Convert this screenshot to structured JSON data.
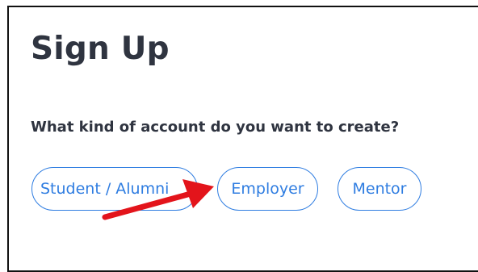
{
  "signup": {
    "title": "Sign Up",
    "question": "What kind of account do you want to create?",
    "options": [
      {
        "label": "Student / Alumni"
      },
      {
        "label": "Employer"
      },
      {
        "label": "Mentor"
      }
    ]
  },
  "colors": {
    "text": "#2f3440",
    "accent": "#2f7de1",
    "arrow": "#e3141b"
  }
}
